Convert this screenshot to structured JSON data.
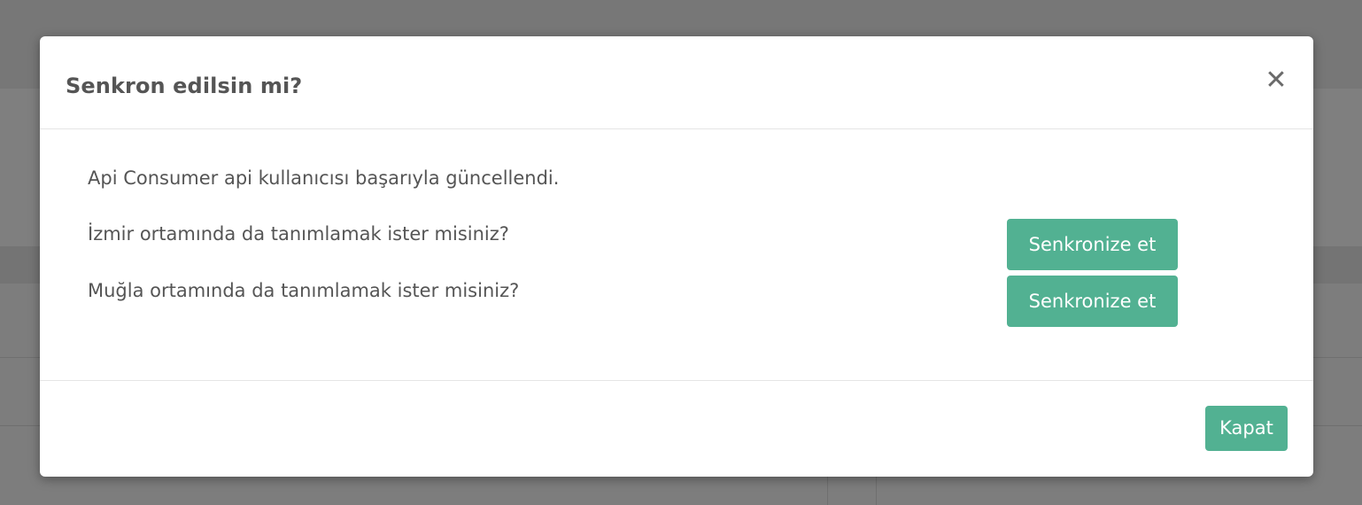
{
  "modal": {
    "title": "Senkron edilsin mi?",
    "close_icon": "close-icon",
    "close_symbol": "✕",
    "message": "Api Consumer api kullanıcısı başarıyla güncellendi.",
    "environments": [
      {
        "question": "İzmir ortamında da tanımlamak ister misiniz?",
        "button_label": "Senkronize et"
      },
      {
        "question": "Muğla ortamında da tanımlamak ister misiniz?",
        "button_label": "Senkronize et"
      }
    ],
    "footer": {
      "close_label": "Kapat"
    }
  },
  "colors": {
    "accent": "#52b192",
    "overlay": "#7d7d7d",
    "text": "#555555"
  }
}
